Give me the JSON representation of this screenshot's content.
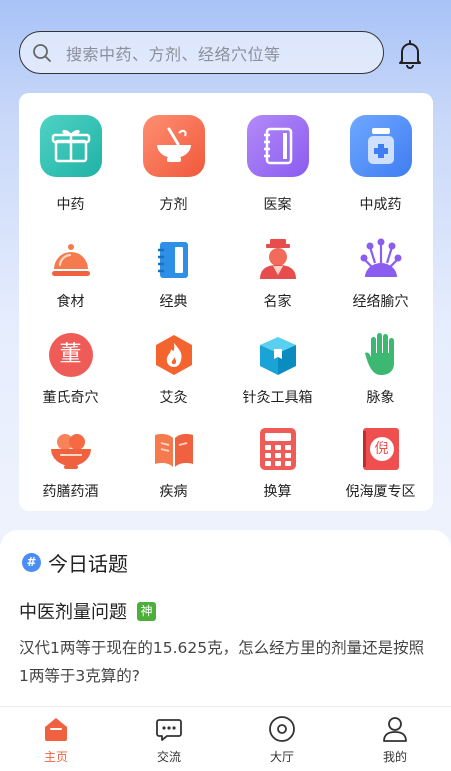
{
  "search": {
    "placeholder": "搜索中药、方剂、经络穴位等"
  },
  "grid": {
    "items": [
      {
        "label": "中药",
        "icon": "gift-box-icon"
      },
      {
        "label": "方剂",
        "icon": "mortar-bowl-icon"
      },
      {
        "label": "医案",
        "icon": "notebook-icon"
      },
      {
        "label": "中成药",
        "icon": "medicine-bottle-icon"
      },
      {
        "label": "食材",
        "icon": "food-cover-icon"
      },
      {
        "label": "经典",
        "icon": "classic-book-icon"
      },
      {
        "label": "名家",
        "icon": "scholar-icon"
      },
      {
        "label": "经络腧穴",
        "icon": "acupoint-icon"
      },
      {
        "label": "董氏奇穴",
        "icon": "dong-seal-icon"
      },
      {
        "label": "艾灸",
        "icon": "moxibustion-flame-icon"
      },
      {
        "label": "针灸工具箱",
        "icon": "toolbox-icon"
      },
      {
        "label": "脉象",
        "icon": "pulse-hand-icon"
      },
      {
        "label": "药膳药酒",
        "icon": "herbal-bowl-icon"
      },
      {
        "label": "疾病",
        "icon": "open-book-icon"
      },
      {
        "label": "换算",
        "icon": "calculator-icon"
      },
      {
        "label": "倪海厦专区",
        "icon": "ni-book-icon"
      }
    ],
    "seal_text": "董",
    "ni_text": "倪"
  },
  "topic": {
    "header": "今日话题",
    "hash_symbol": "#",
    "question_title": "中医剂量问题",
    "badge": "神",
    "question_body": "汉代1两等于现在的15.625克，怎么经方里的剂量还是按照1两等于3克算的?"
  },
  "tabbar": {
    "tabs": [
      {
        "label": "主页",
        "active": true
      },
      {
        "label": "交流",
        "active": false
      },
      {
        "label": "大厅",
        "active": false
      },
      {
        "label": "我的",
        "active": false
      }
    ]
  },
  "colors": {
    "accent": "#f0623f",
    "badge": "#4caf3a",
    "hash": "#4a8ef5"
  }
}
